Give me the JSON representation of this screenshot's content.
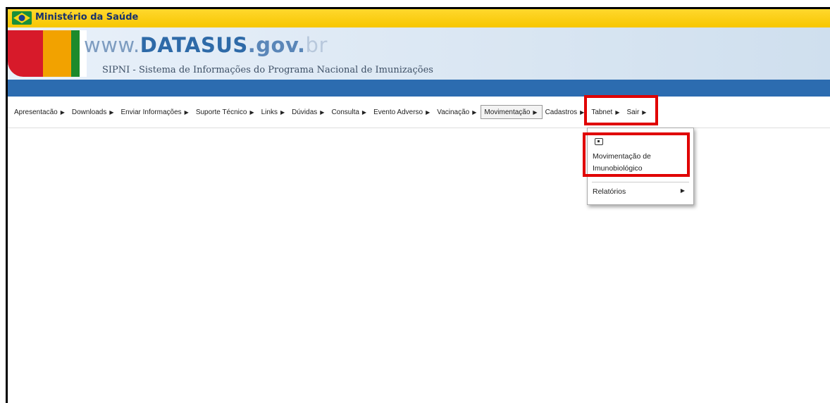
{
  "header": {
    "ministerio": "Ministério da Saúde",
    "brand_www": "www.",
    "brand_name": "DATASUS",
    "brand_gov": ".gov.",
    "brand_br": "br",
    "subtitle": "SIPNI - Sistema de Informações do Programa Nacional de Imunizações"
  },
  "menu": {
    "items": [
      {
        "label": "Apresentacão"
      },
      {
        "label": "Downloads"
      },
      {
        "label": "Enviar Informações"
      },
      {
        "label": "Suporte Técnico"
      },
      {
        "label": "Links"
      },
      {
        "label": "Dúvidas"
      },
      {
        "label": "Consulta"
      },
      {
        "label": "Evento Adverso"
      },
      {
        "label": "Vacinação"
      },
      {
        "label": "Movimentação"
      },
      {
        "label": "Cadastros"
      },
      {
        "label": "Tabnet"
      },
      {
        "label": "Sair"
      }
    ],
    "arrow_glyph": "▶"
  },
  "dropdown": {
    "item1_label": "Movimentação de Imunobiológico",
    "item2_label": "Relatórios",
    "arrow_glyph": "▶"
  },
  "colors": {
    "ministerio_bar": "#f7c600",
    "blue_strip": "#2c6cb0",
    "highlight": "#e00000"
  }
}
